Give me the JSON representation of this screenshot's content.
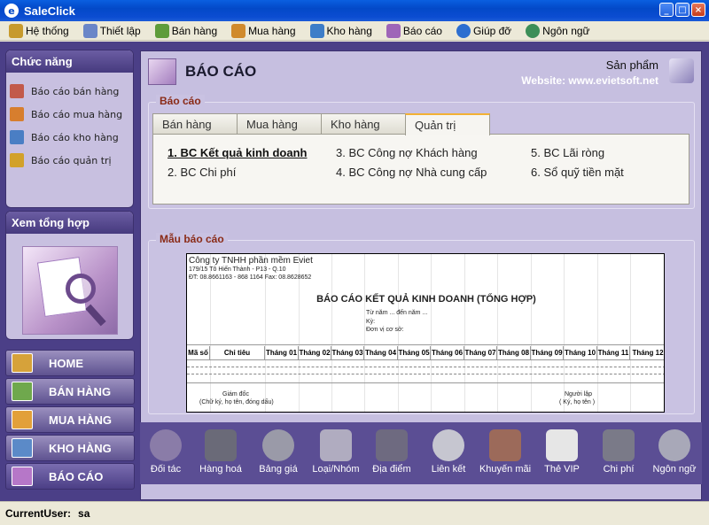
{
  "window": {
    "title": "SaleClick",
    "app_icon": "e"
  },
  "menu": [
    {
      "label": "Hệ thống",
      "icon": "system-icon",
      "color": "#C79A2C"
    },
    {
      "label": "Thiết lập",
      "icon": "settings-icon",
      "color": "#6A86C8"
    },
    {
      "label": "Bán hàng",
      "icon": "sales-icon",
      "color": "#5E9C3A"
    },
    {
      "label": "Mua hàng",
      "icon": "purchase-icon",
      "color": "#D08A2C"
    },
    {
      "label": "Kho hàng",
      "icon": "warehouse-icon",
      "color": "#3D7DC8"
    },
    {
      "label": "Báo cáo",
      "icon": "report-icon",
      "color": "#9E65B8"
    },
    {
      "label": "Giúp đỡ",
      "icon": "help-icon",
      "color": "#2C6ED0"
    },
    {
      "label": "Ngôn ngữ",
      "icon": "language-icon",
      "color": "#3C8E58"
    }
  ],
  "sidebar": {
    "functions_title": "Chức năng",
    "functions": [
      {
        "label": "Báo cáo bán hàng",
        "icon": "sales-report-icon",
        "color": "#C25A4A"
      },
      {
        "label": "Báo cáo mua hàng",
        "icon": "purchase-report-icon",
        "color": "#D77E2E"
      },
      {
        "label": "Báo cáo kho hàng",
        "icon": "warehouse-report-icon",
        "color": "#4A7EC4"
      },
      {
        "label": "Báo cáo quản trị",
        "icon": "admin-report-icon",
        "color": "#D2A12A"
      }
    ],
    "summary_title": "Xem tổng hợp",
    "nav": [
      {
        "label": "HOME",
        "icon": "home-icon",
        "color": "#D6A23A"
      },
      {
        "label": "BÁN HÀNG",
        "icon": "sales-nav-icon",
        "color": "#6FA84D"
      },
      {
        "label": "MUA HÀNG",
        "icon": "purchase-nav-icon",
        "color": "#E2A03A"
      },
      {
        "label": "KHO HÀNG",
        "icon": "warehouse-nav-icon",
        "color": "#5B8AC8"
      },
      {
        "label": "BÁO CÁO",
        "icon": "report-nav-icon",
        "color": "#B677C8"
      }
    ]
  },
  "header": {
    "title": "BÁO CÁO",
    "product_label": "Sản phẩm",
    "website": "Website: www.evietsoft.net"
  },
  "reports": {
    "legend": "Báo cáo",
    "tabs": [
      "Bán hàng",
      "Mua hàng",
      "Kho hàng",
      "Quản trị"
    ],
    "active_tab": "Quản trị",
    "items": [
      "1. BC Kết quả kinh doanh",
      "2. BC Chi phí",
      "3. BC Công nợ Khách hàng",
      "4. BC Công nợ Nhà cung cấp",
      "5. BC Lãi ròng",
      "6. Sổ quỹ tiền mặt"
    ]
  },
  "sample": {
    "legend": "Mẫu báo cáo",
    "company": "Công ty TNHH phần mềm Eviet",
    "address": "179/15 Tô Hiến Thành - P13 - Q.10",
    "phone": "ĐT: 08.8661163 - 868 1164 Fax: 08.8628652",
    "title": "BÁO CÁO KẾT QUẢ KINH DOANH (TỔNG HỢP)",
    "period": "Từ năm ... đến năm ...",
    "ky": "Kỳ:",
    "unit": "Đơn vị cơ sở:",
    "col_code": "Mã số",
    "col_target": "Chỉ tiêu",
    "months": [
      "Tháng 01",
      "Tháng 02",
      "Tháng 03",
      "Tháng 04",
      "Tháng 05",
      "Tháng 06",
      "Tháng 07",
      "Tháng 08",
      "Tháng 09",
      "Tháng 10",
      "Tháng 11",
      "Tháng 12"
    ],
    "director": "Giám đốc",
    "director_note": "(Chữ ký, họ tên, đóng dấu)",
    "preparer": "Người lập",
    "preparer_note": "( Ký, họ tên )"
  },
  "tools": [
    {
      "label": "Đối tác",
      "icon": "partners-icon",
      "color": "#8A7CA8"
    },
    {
      "label": "Hàng hoá",
      "icon": "goods-icon",
      "color": "#6A6A78"
    },
    {
      "label": "Bảng giá",
      "icon": "price-icon",
      "color": "#9A9AA8"
    },
    {
      "label": "Loại/Nhóm",
      "icon": "category-icon",
      "color": "#B0ACC0"
    },
    {
      "label": "Địa điểm",
      "icon": "location-icon",
      "color": "#6E6A80"
    },
    {
      "label": "Liên kết",
      "icon": "link-icon",
      "color": "#C6C6D0"
    },
    {
      "label": "Khuyến mãi",
      "icon": "promotion-icon",
      "color": "#9C6A5A"
    },
    {
      "label": "Thẻ VIP",
      "icon": "vip-card-icon",
      "color": "#E6E6E6"
    },
    {
      "label": "Chi phí",
      "icon": "expense-icon",
      "color": "#7A7A88"
    },
    {
      "label": "Ngôn ngữ",
      "icon": "language-globe-icon",
      "color": "#A8A8B8"
    }
  ],
  "status": {
    "current_user_label": "CurrentUser:",
    "current_user": "sa"
  }
}
